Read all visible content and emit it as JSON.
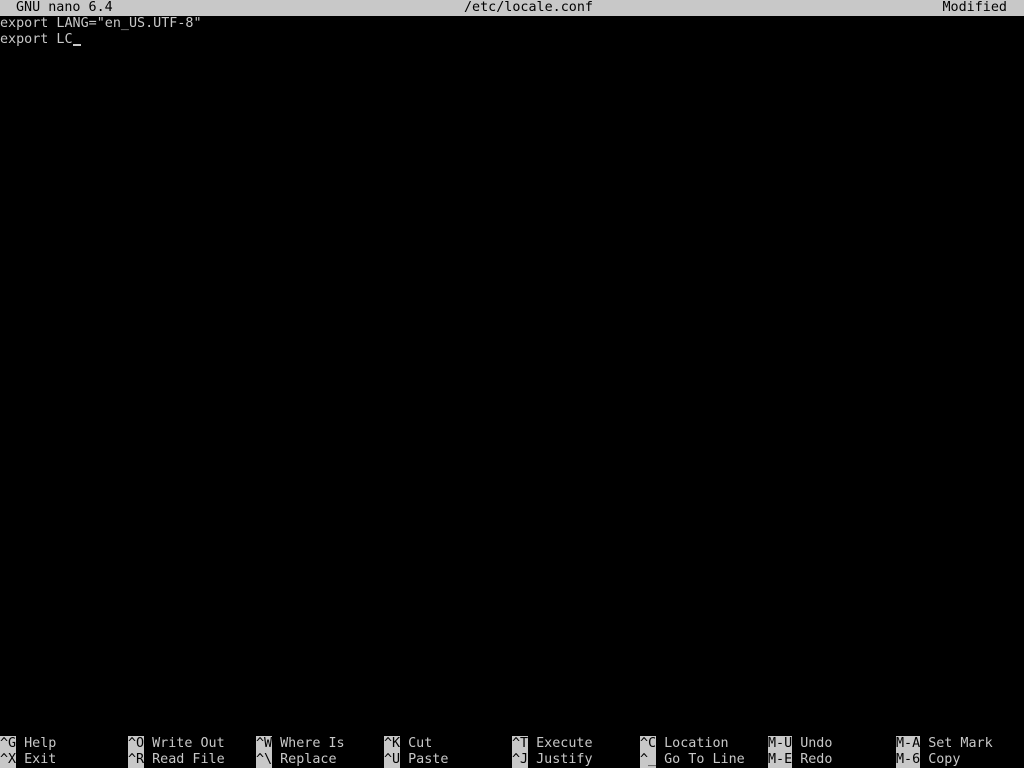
{
  "titlebar": {
    "app": "GNU nano 6.4",
    "file": "/etc/locale.conf",
    "status": "Modified"
  },
  "editor": {
    "lines": [
      "export LANG=\"en_US.UTF-8\"",
      "export LC"
    ]
  },
  "shortcuts": {
    "row1": [
      {
        "key": "^G",
        "label": "Help"
      },
      {
        "key": "^O",
        "label": "Write Out"
      },
      {
        "key": "^W",
        "label": "Where Is"
      },
      {
        "key": "^K",
        "label": "Cut"
      },
      {
        "key": "^T",
        "label": "Execute"
      },
      {
        "key": "^C",
        "label": "Location"
      },
      {
        "key": "M-U",
        "label": "Undo"
      },
      {
        "key": "M-A",
        "label": "Set Mark"
      }
    ],
    "row2": [
      {
        "key": "^X",
        "label": "Exit"
      },
      {
        "key": "^R",
        "label": "Read File"
      },
      {
        "key": "^\\",
        "label": "Replace"
      },
      {
        "key": "^U",
        "label": "Paste"
      },
      {
        "key": "^J",
        "label": "Justify"
      },
      {
        "key": "^_",
        "label": "Go To Line"
      },
      {
        "key": "M-E",
        "label": "Redo"
      },
      {
        "key": "M-6",
        "label": "Copy"
      }
    ]
  },
  "colors": {
    "background": "#000000",
    "foreground": "#c8c8c8",
    "inverse_bg": "#c8c8c8",
    "inverse_fg": "#000000"
  }
}
